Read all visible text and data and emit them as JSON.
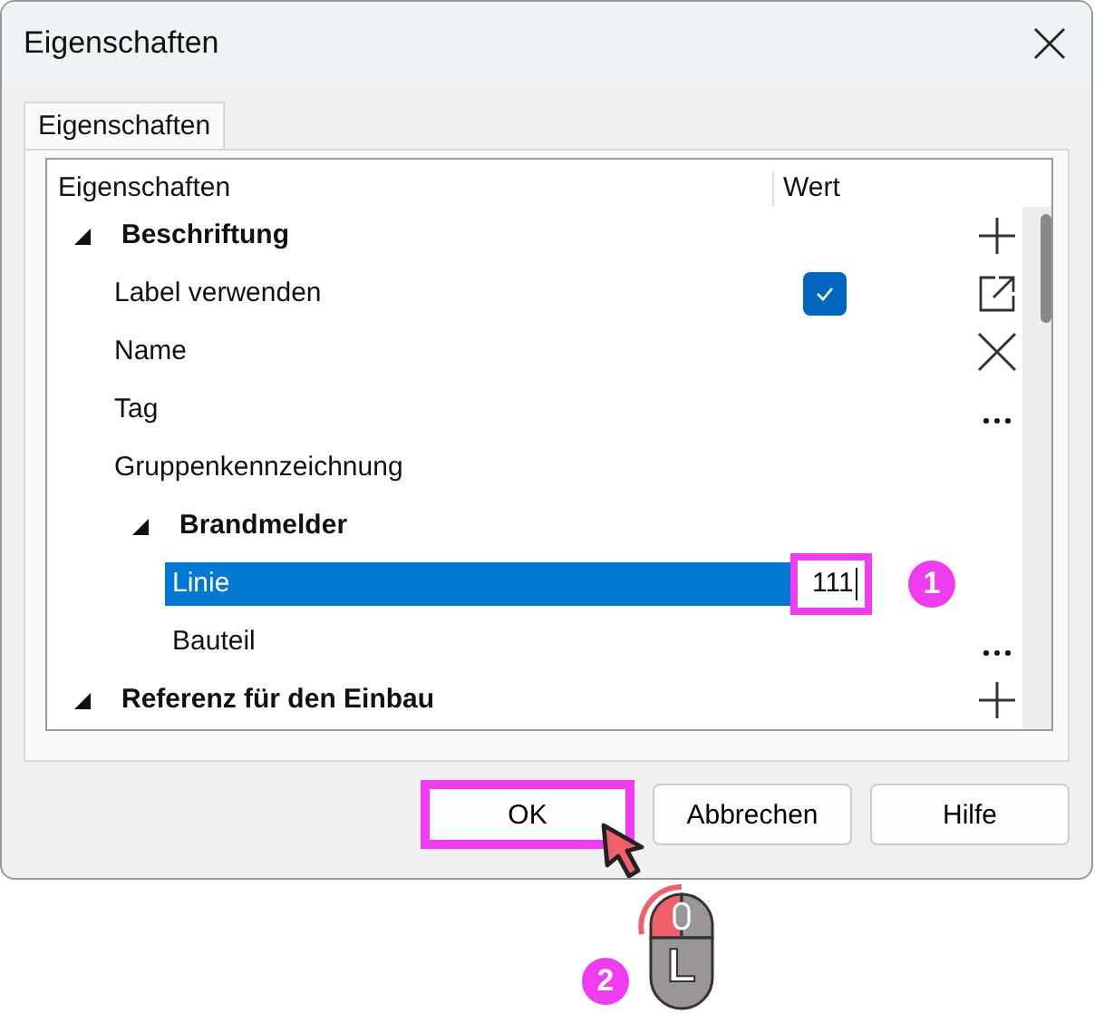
{
  "window": {
    "title": "Eigenschaften"
  },
  "tabs": [
    {
      "label": "Eigenschaften",
      "selected": true
    }
  ],
  "grid": {
    "columns": [
      "Eigenschaften",
      "Wert"
    ],
    "rows": [
      {
        "kind": "group",
        "label": "Beschriftung",
        "expanded": true,
        "selected": false,
        "action": {
          "kind": "add"
        },
        "children": [
          {
            "kind": "checkbox",
            "label": "Label verwenden",
            "checked": true,
            "selected": false,
            "action": {
              "kind": "open"
            }
          },
          {
            "kind": "text",
            "label": "Name",
            "selected": false,
            "action": {
              "kind": "clear"
            }
          },
          {
            "kind": "text",
            "label": "Tag",
            "selected": false,
            "action": {
              "kind": "more"
            }
          },
          {
            "kind": "text",
            "label": "Gruppenkennzeichnung",
            "selected": false
          },
          {
            "kind": "group",
            "label": "Brandmelder",
            "expanded": true,
            "selected": false,
            "children": [
              {
                "kind": "text",
                "label": "Linie",
                "value": "111",
                "selected": true,
                "highlighted": true,
                "badge": "1"
              },
              {
                "kind": "text",
                "label": "Bauteil",
                "selected": false,
                "action": {
                  "kind": "more"
                }
              }
            ]
          }
        ]
      },
      {
        "kind": "group",
        "label": "Referenz für den Einbau",
        "expanded": true,
        "selected": false,
        "action": {
          "kind": "add"
        }
      }
    ]
  },
  "buttons": [
    {
      "label": "OK",
      "highlighted": true
    },
    {
      "label": "Abbrechen",
      "highlighted": false
    },
    {
      "label": "Hilfe",
      "highlighted": false
    }
  ],
  "click_hint": {
    "badge": "2",
    "mouse_button": "L"
  }
}
